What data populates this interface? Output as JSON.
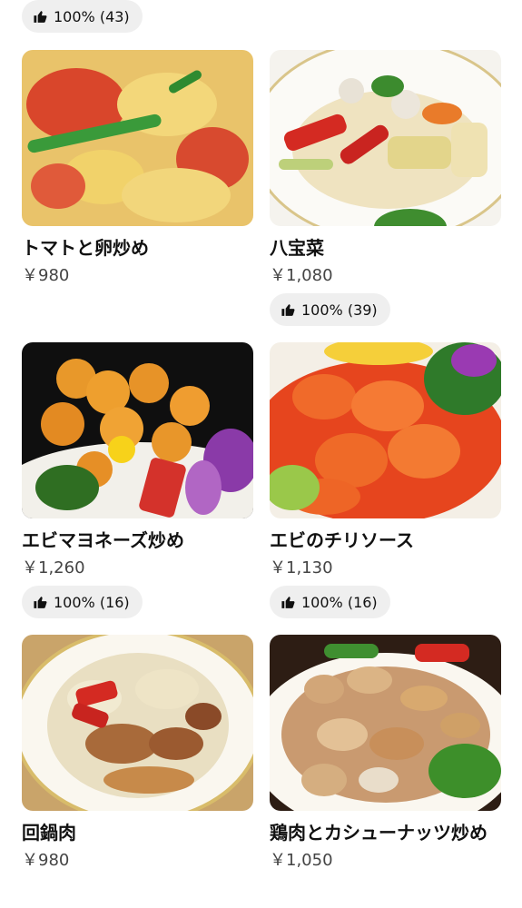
{
  "top_badge": {
    "text": "100% (43)"
  },
  "items": [
    {
      "name": "トマトと卵炒め",
      "price": "￥980"
    },
    {
      "name": "八宝菜",
      "price": "￥1,080",
      "rating": "100% (39)"
    },
    {
      "name": "エビマヨネーズ炒め",
      "price": "￥1,260",
      "rating": "100% (16)"
    },
    {
      "name": "エビのチリソース",
      "price": "￥1,130",
      "rating": "100% (16)"
    },
    {
      "name": "回鍋肉",
      "price": "￥980"
    },
    {
      "name": "鶏肉とカシューナッツ炒め",
      "price": "￥1,050"
    }
  ],
  "icons": {
    "rating": "thumbs-up-icon"
  }
}
